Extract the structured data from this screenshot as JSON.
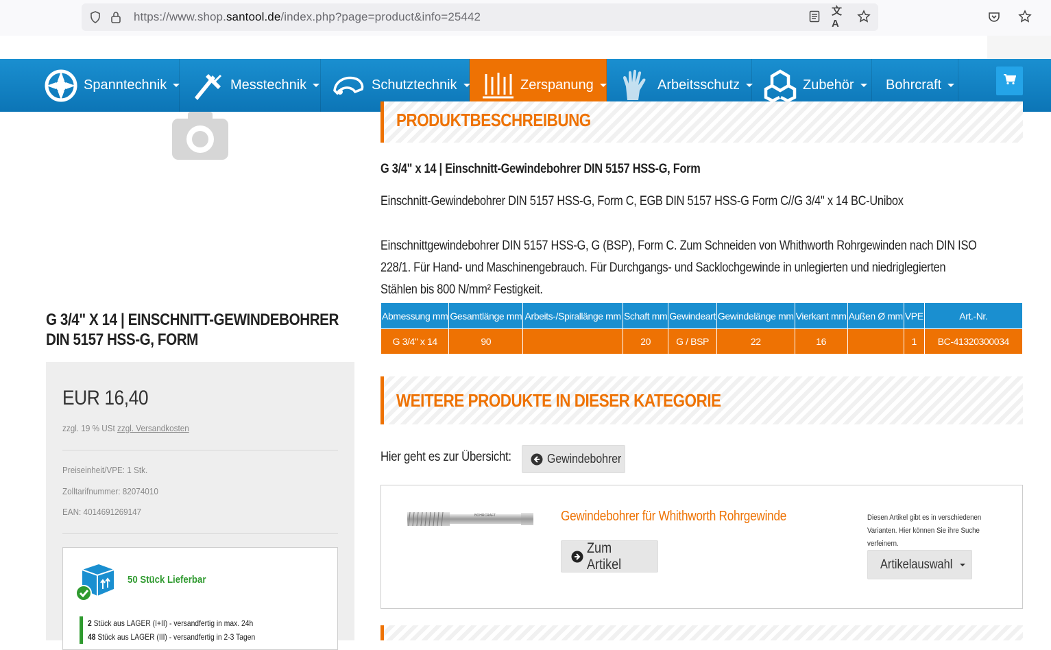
{
  "browser": {
    "url_prefix": "https://www.shop.",
    "url_domain": "santool.de",
    "url_path": "/index.php?page=product&info=25442"
  },
  "nav": {
    "items": [
      {
        "label": "Spanntechnik"
      },
      {
        "label": "Messtechnik"
      },
      {
        "label": "Schutztechnik"
      },
      {
        "label": "Zerspanung"
      },
      {
        "label": "Arbeitsschutz"
      },
      {
        "label": "Zubehör"
      },
      {
        "label": "Bohrcraft"
      }
    ]
  },
  "product": {
    "title_line1": "G 3/4\" x 14 | Einschnitt-Gewindebohrer",
    "title_line2": "DIN 5157 HSS-G, Form",
    "price": "EUR 16,40",
    "tax_text": "zzgl. 19 % USt",
    "shipping_link": "zzgl. Versandkosten",
    "unit": "Preiseinheit/VPE: 1 Stk.",
    "tariff": "Zolltarifnummer: 82074010",
    "ean": "EAN: 4014691269147",
    "stock_title": "50 Stück Lieferbar",
    "stock_lines": [
      {
        "qty": "2",
        "text": " Stück aus LAGER (I+II) - versandfertig in max. 24h"
      },
      {
        "qty": "48",
        "text": " Stück aus LAGER (III) - versandfertig in 2-3 Tagen"
      }
    ]
  },
  "description": {
    "heading": "PRODUKTBESCHREIBUNG",
    "title": "G 3/4\" x 14 | Einschnitt-Gewindebohrer DIN 5157 HSS-G, Form",
    "line1": "Einschnitt-Gewindebohrer DIN 5157 HSS-G, Form C, EGB DIN 5157 HSS-G Form C//G 3/4\" x 14 BC-Unibox",
    "para_lines": [
      "Einschnittgewindebohrer DIN 5157 HSS-G, G (BSP), Form C. Zum Schneiden von Whithworth Rohrgewinden nach DIN ISO",
      "228/1. Für Hand- und Maschinengebrauch. Für Durchgangs- und Sacklochgewinde in unlegierten und niedriglegierten",
      "Stählen bis 800 N/mm² Festigkeit."
    ]
  },
  "spec_table": {
    "headers": [
      "Abmessung mm",
      "Gesamtlänge mm",
      "Arbeits-/Spirallänge mm",
      "Schaft mm",
      "Gewindeart",
      "Gewindelänge mm",
      "Vierkant mm",
      "Außen Ø mm",
      "VPE",
      "Art.-Nr."
    ],
    "row": [
      "G 3/4\" x 14",
      "90",
      "",
      "20",
      "G / BSP",
      "22",
      "16",
      "",
      "1",
      "BC-41320300034"
    ]
  },
  "more": {
    "heading": "WEITERE PRODUKTE IN DIESER KATEGORIE",
    "overview_label": "Hier geht es zur Übersicht:",
    "overview_button": "Gewindebohrer",
    "card": {
      "title": "Gewindebohrer für Whithworth Rohrgewinde",
      "button": "Zum Artikel",
      "note": "Diesen Artikel gibt es in verschiedenen Varianten. Hier können Sie ihre Suche verfeinern.",
      "select": "Artikelauswahl",
      "tool_brand": "BOHRCRAFT"
    }
  },
  "colors": {
    "accent": "#ee7203",
    "nav": "#1a8fd0",
    "stock_green": "#2f9a2f"
  }
}
